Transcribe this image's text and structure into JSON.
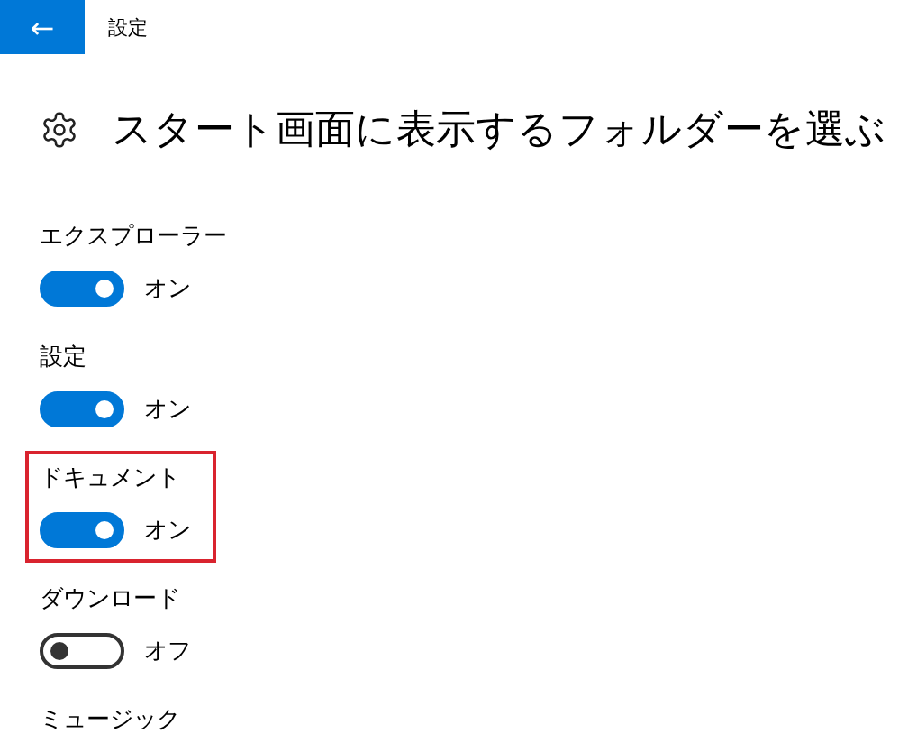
{
  "header": {
    "back_icon": "←",
    "title": "設定"
  },
  "page": {
    "title": "スタート画面に表示するフォルダーを選ぶ"
  },
  "items": [
    {
      "label": "エクスプローラー",
      "on": true,
      "state_text": "オン",
      "highlighted": false
    },
    {
      "label": "設定",
      "on": true,
      "state_text": "オン",
      "highlighted": false
    },
    {
      "label": "ドキュメント",
      "on": true,
      "state_text": "オン",
      "highlighted": true
    },
    {
      "label": "ダウンロード",
      "on": false,
      "state_text": "オフ",
      "highlighted": false
    },
    {
      "label": "ミュージック",
      "highlighted": false
    }
  ]
}
